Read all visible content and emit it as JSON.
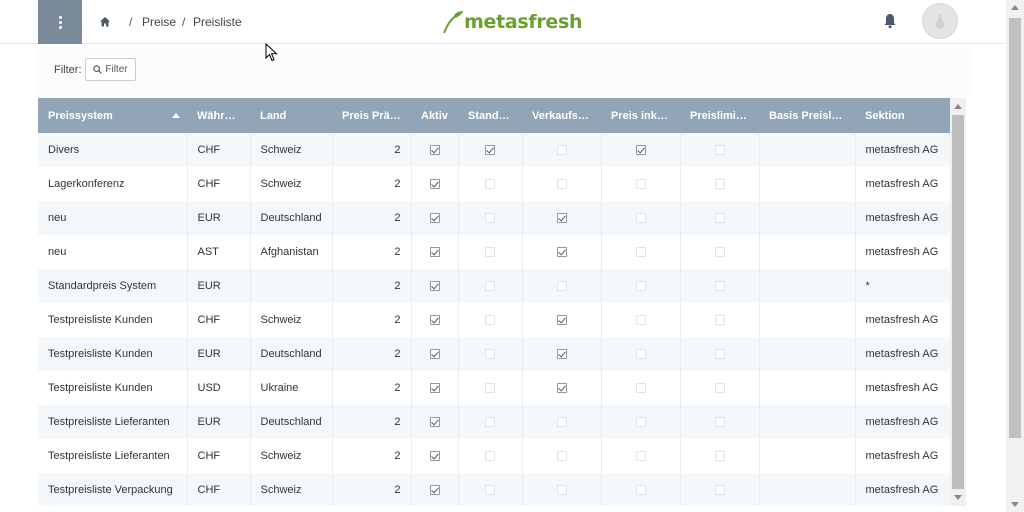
{
  "header": {
    "breadcrumb": [
      "Preise",
      "Preisliste"
    ],
    "logo": "metasfresh"
  },
  "filter": {
    "label": "Filter:",
    "button_label": "Filter"
  },
  "table": {
    "columns": [
      "Preissystem",
      "Währung",
      "Land",
      "Preis Präz…",
      "Aktiv",
      "Standard",
      "Verkaufsp…",
      "Preis inklu…",
      "Preislimit …",
      "Basis Preisliste",
      "Sektion"
    ],
    "rows": [
      {
        "preissystem": "Divers",
        "waehrung": "CHF",
        "land": "Schweiz",
        "praez": "2",
        "aktiv": true,
        "standard": true,
        "verkauf": false,
        "inkl": true,
        "limit": false,
        "basis": "",
        "sektion": "metasfresh AG"
      },
      {
        "preissystem": "Lagerkonferenz",
        "waehrung": "CHF",
        "land": "Schweiz",
        "praez": "2",
        "aktiv": true,
        "standard": false,
        "verkauf": false,
        "inkl": false,
        "limit": false,
        "basis": "",
        "sektion": "metasfresh AG"
      },
      {
        "preissystem": "neu",
        "waehrung": "EUR",
        "land": "Deutschland",
        "praez": "2",
        "aktiv": true,
        "standard": false,
        "verkauf": true,
        "inkl": false,
        "limit": false,
        "basis": "",
        "sektion": "metasfresh AG"
      },
      {
        "preissystem": "neu",
        "waehrung": "AST",
        "land": "Afghanistan",
        "praez": "2",
        "aktiv": true,
        "standard": false,
        "verkauf": true,
        "inkl": false,
        "limit": false,
        "basis": "",
        "sektion": "metasfresh AG"
      },
      {
        "preissystem": "Standardpreis System",
        "waehrung": "EUR",
        "land": "",
        "praez": "2",
        "aktiv": true,
        "standard": false,
        "verkauf": false,
        "inkl": false,
        "limit": false,
        "basis": "",
        "sektion": "*"
      },
      {
        "preissystem": "Testpreisliste Kunden",
        "waehrung": "CHF",
        "land": "Schweiz",
        "praez": "2",
        "aktiv": true,
        "standard": false,
        "verkauf": true,
        "inkl": false,
        "limit": false,
        "basis": "",
        "sektion": "metasfresh AG"
      },
      {
        "preissystem": "Testpreisliste Kunden",
        "waehrung": "EUR",
        "land": "Deutschland",
        "praez": "2",
        "aktiv": true,
        "standard": false,
        "verkauf": true,
        "inkl": false,
        "limit": false,
        "basis": "",
        "sektion": "metasfresh AG"
      },
      {
        "preissystem": "Testpreisliste Kunden",
        "waehrung": "USD",
        "land": "Ukraine",
        "praez": "2",
        "aktiv": true,
        "standard": false,
        "verkauf": true,
        "inkl": false,
        "limit": false,
        "basis": "",
        "sektion": "metasfresh AG"
      },
      {
        "preissystem": "Testpreisliste Lieferanten",
        "waehrung": "EUR",
        "land": "Deutschland",
        "praez": "2",
        "aktiv": true,
        "standard": false,
        "verkauf": false,
        "inkl": false,
        "limit": false,
        "basis": "",
        "sektion": "metasfresh AG"
      },
      {
        "preissystem": "Testpreisliste Lieferanten",
        "waehrung": "CHF",
        "land": "Schweiz",
        "praez": "2",
        "aktiv": true,
        "standard": false,
        "verkauf": false,
        "inkl": false,
        "limit": false,
        "basis": "",
        "sektion": "metasfresh AG"
      },
      {
        "preissystem": "Testpreisliste Verpackung",
        "waehrung": "CHF",
        "land": "Schweiz",
        "praez": "2",
        "aktiv": true,
        "standard": false,
        "verkauf": false,
        "inkl": false,
        "limit": false,
        "basis": "",
        "sektion": "metasfresh AG"
      }
    ]
  },
  "colors": {
    "header_bg": "#91a5b6",
    "menu_bg": "#7a8a9b",
    "logo_green": "#6aa02e",
    "row_alt": "#f4f8fb"
  }
}
